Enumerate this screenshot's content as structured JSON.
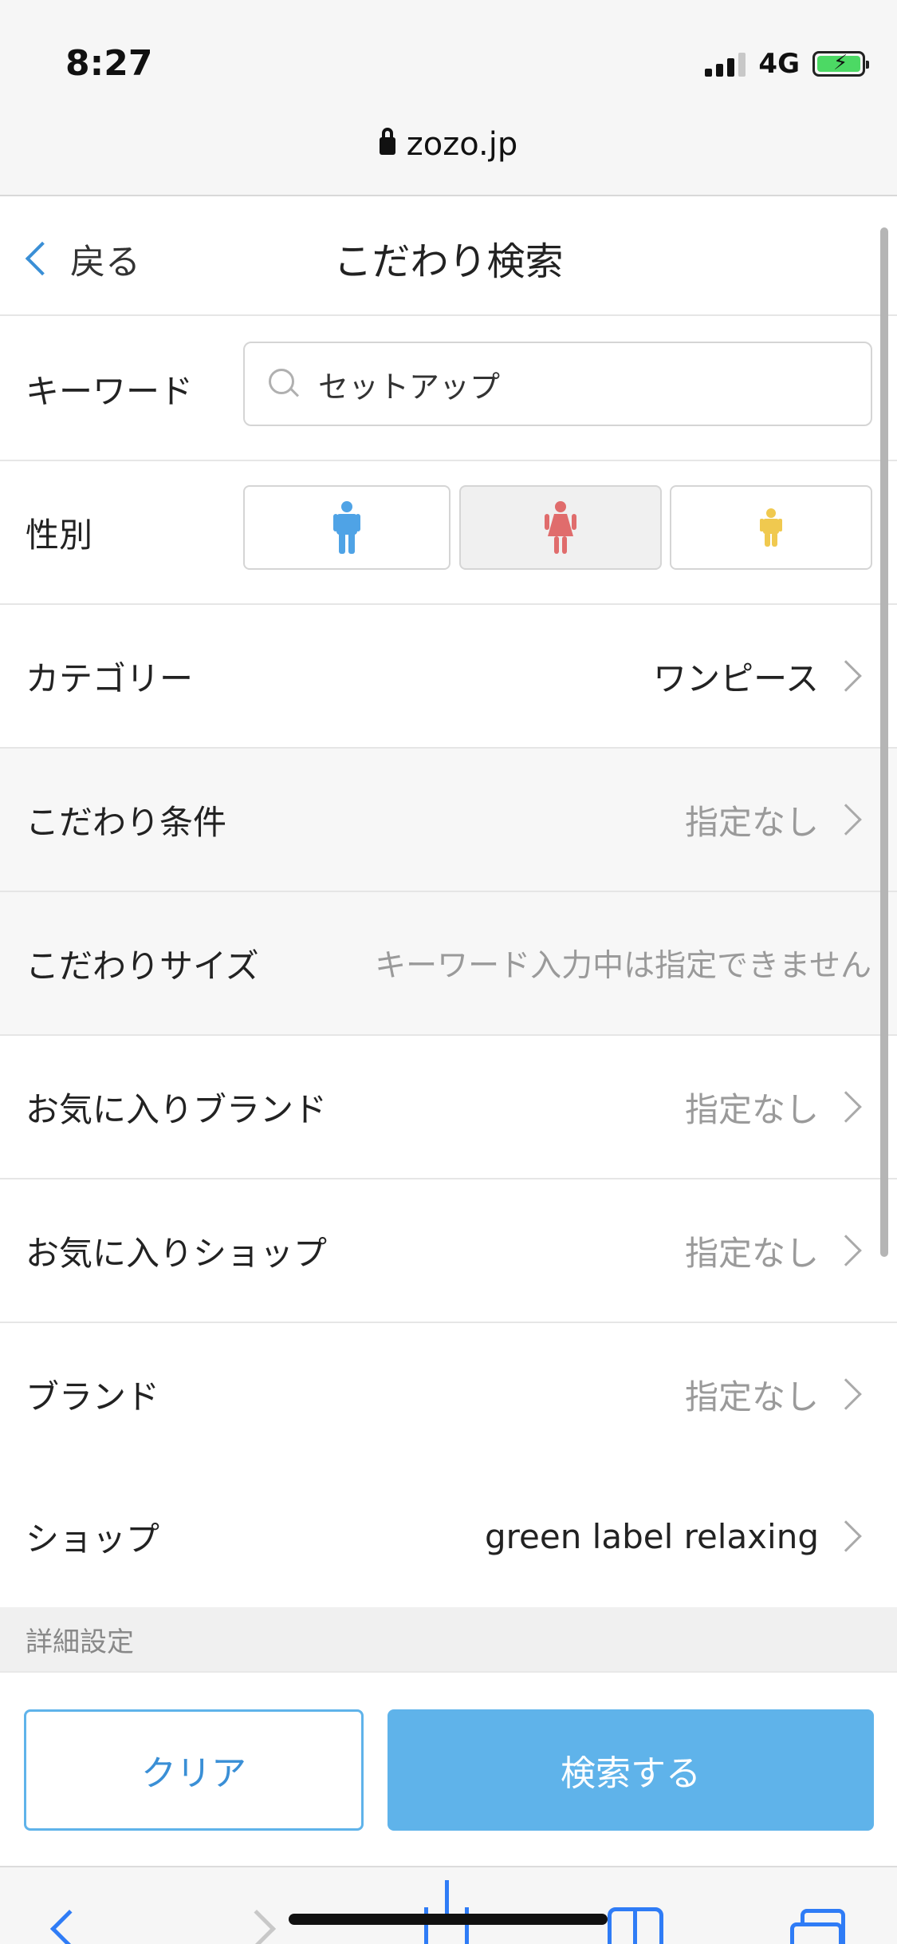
{
  "status_bar": {
    "time": "8:27",
    "network": "4G"
  },
  "browser": {
    "url": "zozo.jp"
  },
  "header": {
    "back_label": "戻る",
    "title": "こだわり検索"
  },
  "keyword": {
    "label": "キーワード",
    "value": "セットアップ"
  },
  "gender": {
    "label": "性別",
    "options": [
      {
        "name": "men",
        "color": "#4fa3e6"
      },
      {
        "name": "women",
        "color": "#e06c6c",
        "selected": true
      },
      {
        "name": "kids",
        "color": "#f0c94f"
      }
    ]
  },
  "rows": {
    "category": {
      "label": "カテゴリー",
      "value": "ワンピース"
    },
    "conditions": {
      "label": "こだわり条件",
      "value": "指定なし"
    },
    "size": {
      "label": "こだわりサイズ",
      "value": "キーワード入力中は指定できません"
    },
    "favorite_brand": {
      "label": "お気に入りブランド",
      "value": "指定なし"
    },
    "favorite_shop": {
      "label": "お気に入りショップ",
      "value": "指定なし"
    },
    "brand": {
      "label": "ブランド",
      "value": "指定なし"
    },
    "shop": {
      "label": "ショップ",
      "value": "green label relaxing"
    }
  },
  "section": {
    "detail_label": "詳細設定"
  },
  "buttons": {
    "clear": "クリア",
    "search": "検索する"
  },
  "colors": {
    "accent": "#5fb3ea",
    "accent_text": "#3a8fd6",
    "safari_blue": "#2f7cf6"
  }
}
